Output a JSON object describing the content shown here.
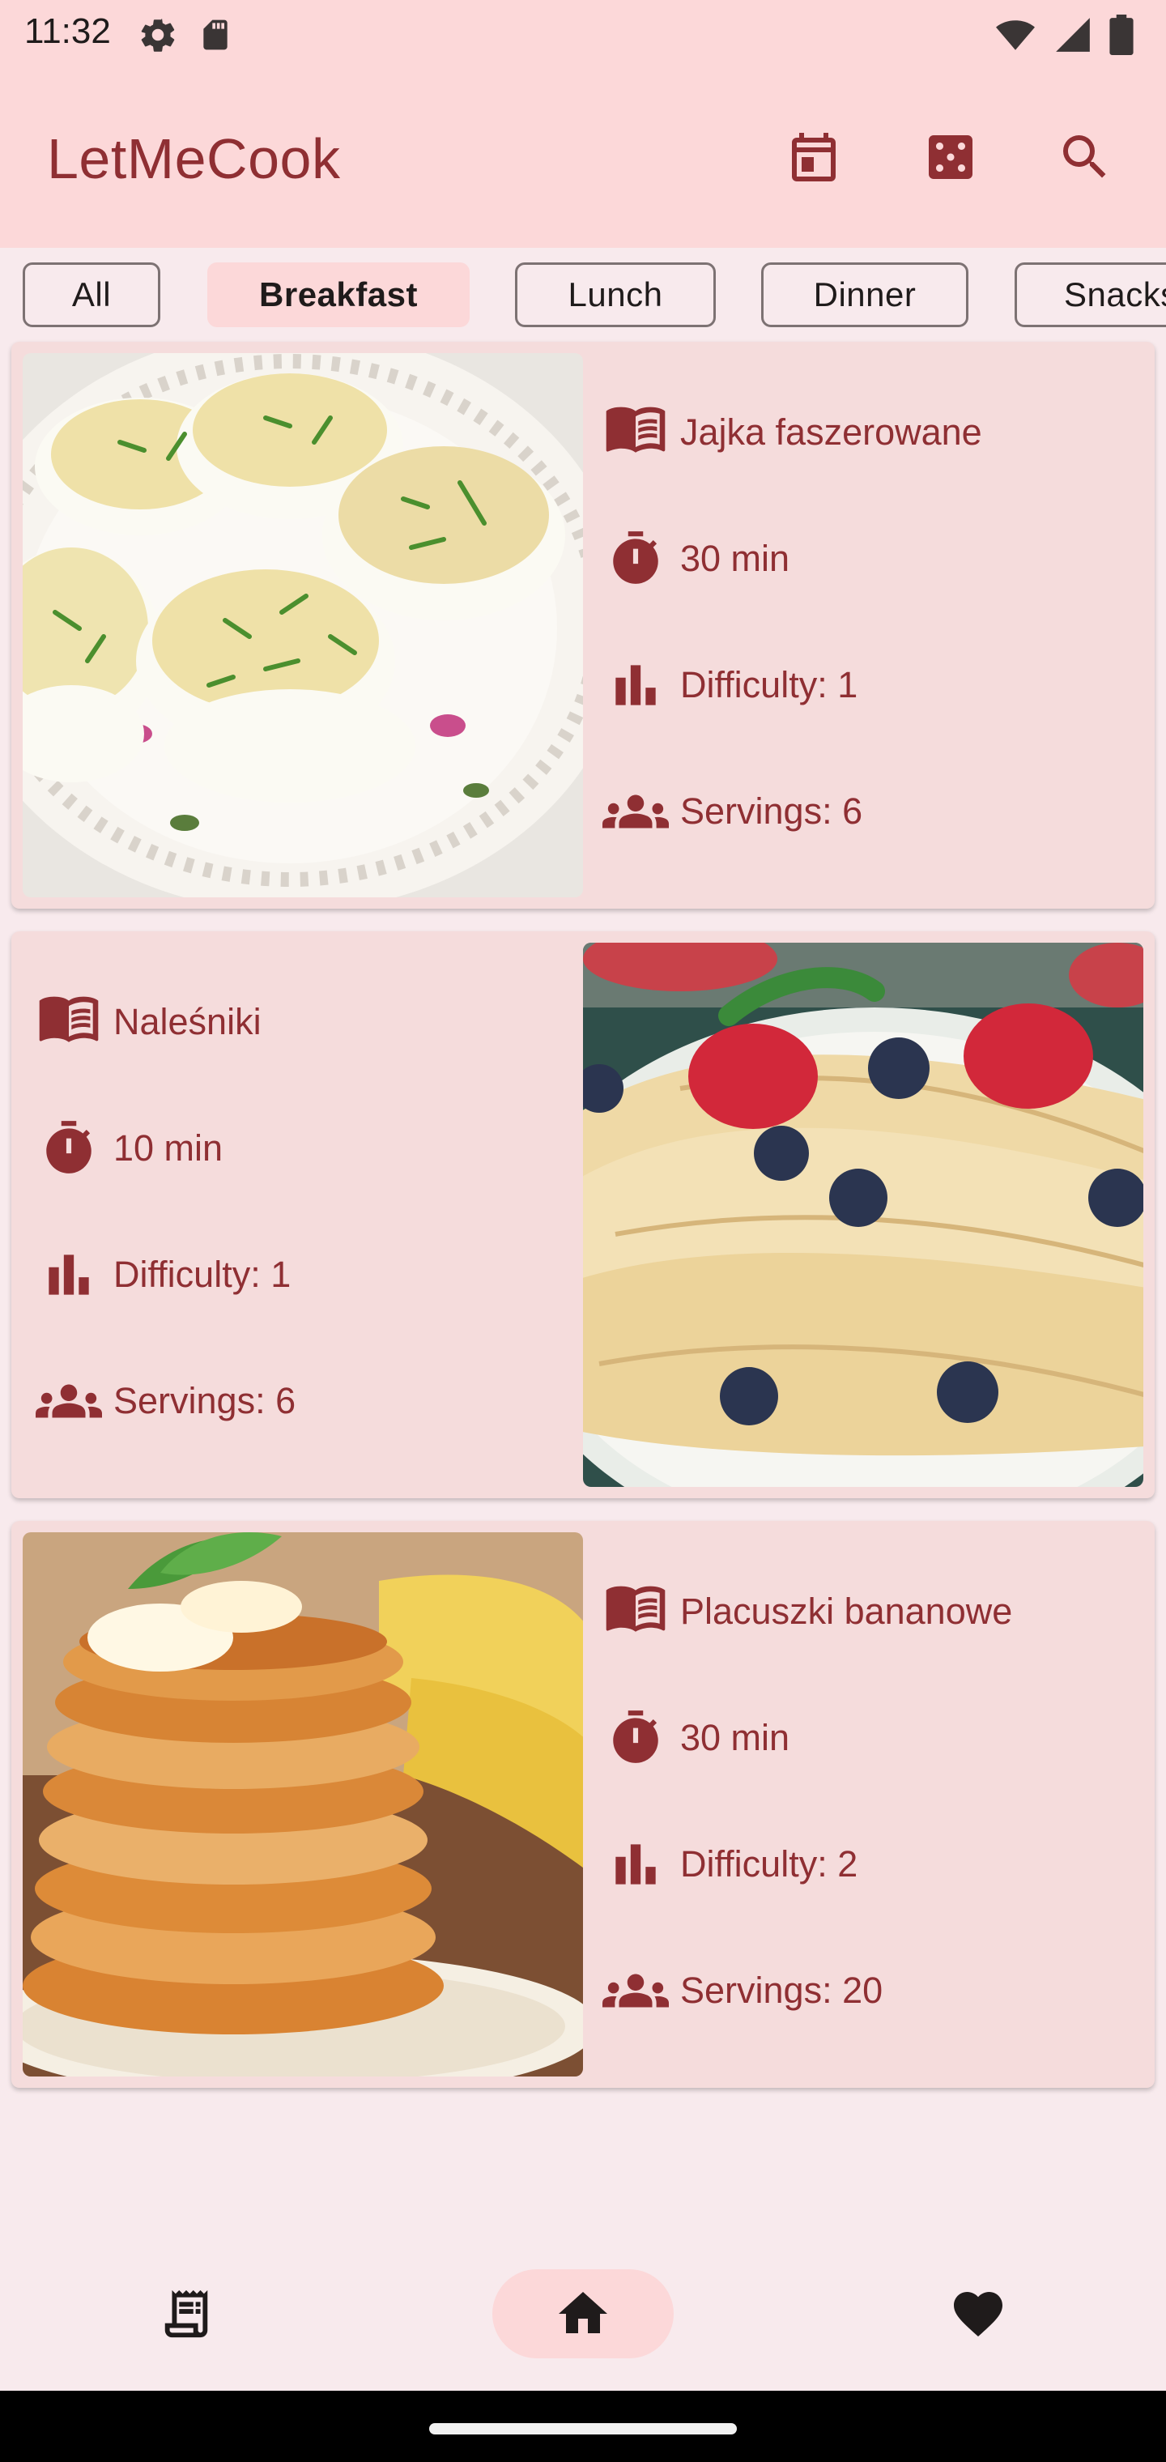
{
  "status_bar": {
    "time": "11:32"
  },
  "app_bar": {
    "title": "LetMeCook",
    "actions": [
      "calendar-icon",
      "dice-icon",
      "search-icon"
    ]
  },
  "tabs": [
    {
      "label": "All",
      "selected": false
    },
    {
      "label": "Breakfast",
      "selected": true
    },
    {
      "label": "Lunch",
      "selected": false
    },
    {
      "label": "Dinner",
      "selected": false
    },
    {
      "label": "Snacks",
      "selected": false
    }
  ],
  "recipes": [
    {
      "name": "Jajka faszerowane",
      "time": "30 min",
      "difficulty": "Difficulty: 1",
      "servings": "Servings: 6",
      "image": "stuffed-eggs"
    },
    {
      "name": "Naleśniki",
      "time": "10 min",
      "difficulty": "Difficulty: 1",
      "servings": "Servings: 6",
      "image": "crepes-with-berries"
    },
    {
      "name": "Placuszki bananowe",
      "time": "30 min",
      "difficulty": "Difficulty: 2",
      "servings": "Servings: 20",
      "image": "banana-pancakes"
    }
  ],
  "bottom_nav": [
    {
      "icon": "receipt-icon",
      "active": false
    },
    {
      "icon": "home-icon",
      "active": true
    },
    {
      "icon": "heart-icon",
      "active": false
    }
  ],
  "colors": {
    "accent": "#8f2f33",
    "app_bar_bg": "#fcd8d9",
    "card_bg": "#f5dcdc",
    "page_bg": "#f8eaed"
  }
}
